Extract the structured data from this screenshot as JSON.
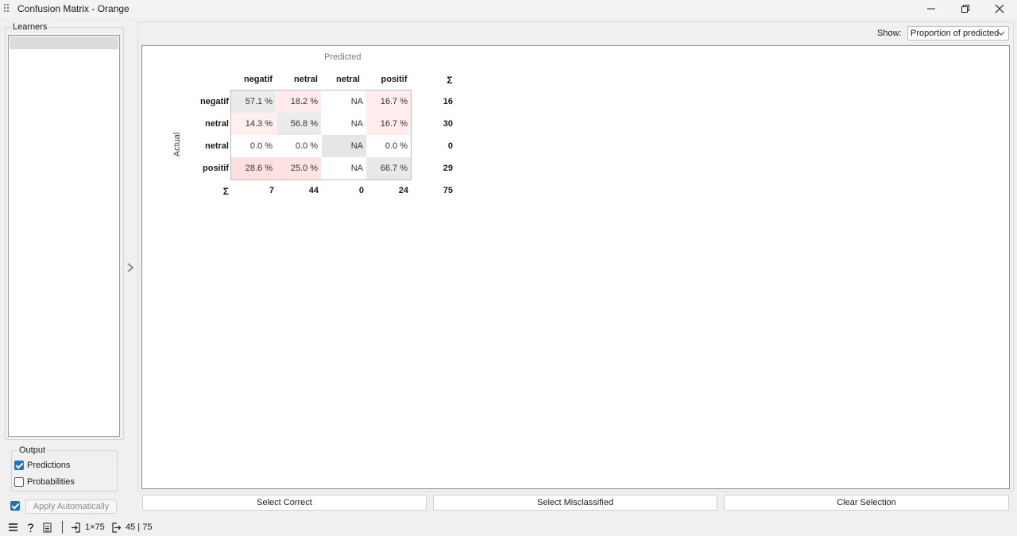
{
  "window": {
    "title": "Confusion Matrix - Orange"
  },
  "left_panel": {
    "learners_label": "Learners",
    "output_label": "Output",
    "predictions_label": "Predictions",
    "predictions_checked": true,
    "probabilities_label": "Probabilities",
    "probabilities_checked": false,
    "apply_label": "Apply Automatically",
    "apply_checked": true
  },
  "show": {
    "label": "Show:",
    "selected": "Proportion of predicted"
  },
  "matrix": {
    "predicted_label": "Predicted",
    "actual_label": "Actual",
    "sigma": "Σ",
    "columns": [
      "negatif",
      "netral",
      "netral",
      "positif"
    ],
    "rows": [
      {
        "label": "negatif",
        "cells": [
          "57.1 %",
          "18.2 %",
          "NA",
          "16.7 %"
        ],
        "shades": [
          0.571,
          0.182,
          null,
          0.167
        ],
        "total": "16"
      },
      {
        "label": "netral",
        "cells": [
          "14.3 %",
          "56.8 %",
          "NA",
          "16.7 %"
        ],
        "shades": [
          0.143,
          0.568,
          null,
          0.167
        ],
        "total": "30"
      },
      {
        "label": "netral",
        "cells": [
          "0.0 %",
          "0.0 %",
          "NA",
          "0.0 %"
        ],
        "shades": [
          0.0,
          0.0,
          null,
          0.0
        ],
        "total": "0"
      },
      {
        "label": "positif",
        "cells": [
          "28.6 %",
          "25.0 %",
          "NA",
          "66.7 %"
        ],
        "shades": [
          0.286,
          0.25,
          null,
          0.667
        ],
        "total": "29"
      }
    ],
    "column_totals": [
      "7",
      "44",
      "0",
      "24"
    ],
    "grand_total": "75"
  },
  "buttons": {
    "select_correct": "Select Correct",
    "select_misclassified": "Select Misclassified",
    "clear_selection": "Clear Selection"
  },
  "status": {
    "input_summary": "1×75",
    "output_summary": "45 | 75"
  },
  "colors": {
    "diagonal": "#e8e8e8",
    "off_diagonal_base": "#f2c6c6",
    "na": "#e6e6e6",
    "accent": "#1a73c8"
  }
}
